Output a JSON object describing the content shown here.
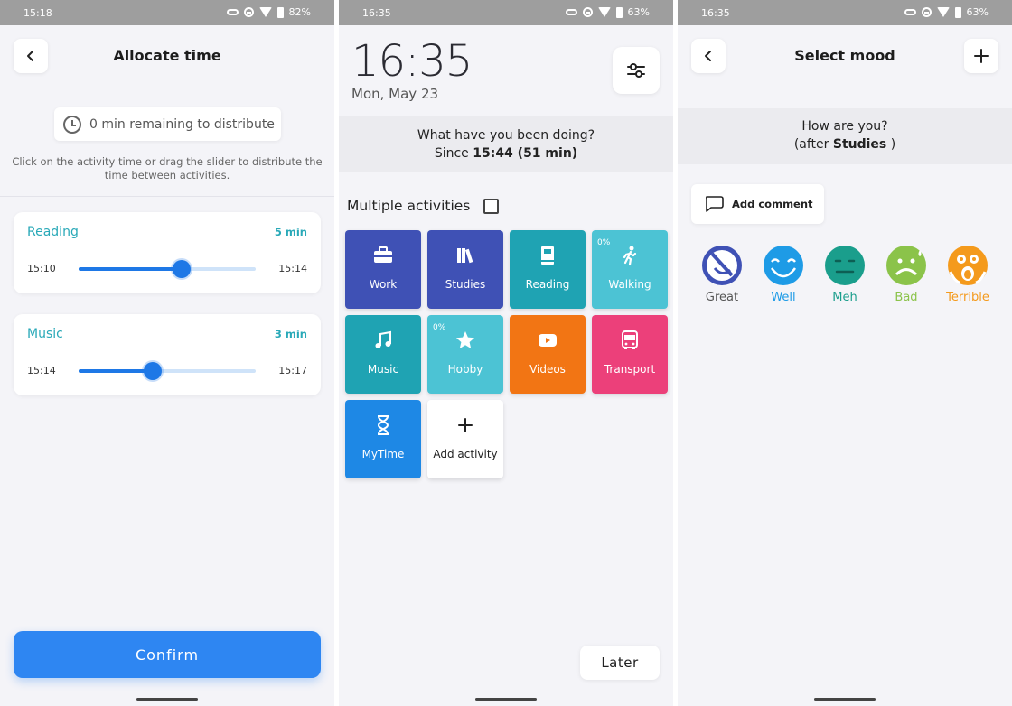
{
  "colors": {
    "accent": "#1e78e6",
    "teal": "#29a9b8",
    "work": "#3f51b5",
    "cyan": "#26b5c6",
    "orange": "#f27514",
    "pink": "#ec407a",
    "blue": "#1e88e5"
  },
  "screen1": {
    "status": {
      "time": "15:18",
      "battery": "82%"
    },
    "title": "Allocate time",
    "remaining": "0 min remaining to distribute",
    "hint": "Click on the activity time or drag the slider to distribute the time between activities.",
    "activities": [
      {
        "name": "Reading",
        "duration": "5 min",
        "start": "15:10",
        "end": "15:14",
        "slider_fraction": 0.58
      },
      {
        "name": "Music",
        "duration": "3 min",
        "start": "15:14",
        "end": "15:17",
        "slider_fraction": 0.42
      }
    ],
    "confirm": "Confirm"
  },
  "screen2": {
    "status": {
      "time": "16:35",
      "battery": "63%"
    },
    "clock": "16:35",
    "date": "Mon, May 23",
    "question": "What have you been doing?",
    "since_prefix": "Since",
    "since_value": "15:44 (51 min)",
    "multiple_label": "Multiple activities",
    "tiles": [
      {
        "label": "Work",
        "icon": "briefcase-icon",
        "color": "#3f51b5"
      },
      {
        "label": "Studies",
        "icon": "books-icon",
        "color": "#3f51b5"
      },
      {
        "label": "Reading",
        "icon": "book-icon",
        "color": "#1fa3b3"
      },
      {
        "label": "Walking",
        "icon": "walking-icon",
        "color": "#4cc3d4",
        "pct": "0%"
      },
      {
        "label": "Music",
        "icon": "music-note-icon",
        "color": "#1fa3b3"
      },
      {
        "label": "Hobby",
        "icon": "star-icon",
        "color": "#4cc3d4",
        "pct": "0%"
      },
      {
        "label": "Videos",
        "icon": "youtube-icon",
        "color": "#f27514"
      },
      {
        "label": "Transport",
        "icon": "bus-icon",
        "color": "#ec407a"
      },
      {
        "label": "MyTime",
        "icon": "hourglass-icon",
        "color": "#1e88e5"
      },
      {
        "label": "Add activity",
        "icon": "plus-icon",
        "color": "#ffffff"
      }
    ],
    "later": "Later"
  },
  "screen3": {
    "status": {
      "time": "16:35",
      "battery": "63%"
    },
    "title": "Select mood",
    "question": "How are you?",
    "after_prefix": "(after",
    "after_activity": "Studies",
    "after_suffix": ")",
    "add_comment": "Add comment",
    "moods": [
      {
        "label": "Great",
        "color": "#3f51b5"
      },
      {
        "label": "Well",
        "color": "#1e9be6"
      },
      {
        "label": "Meh",
        "color": "#1a9e8c"
      },
      {
        "label": "Bad",
        "color": "#8bc34a"
      },
      {
        "label": "Terrible",
        "color": "#f49a1c"
      }
    ]
  }
}
